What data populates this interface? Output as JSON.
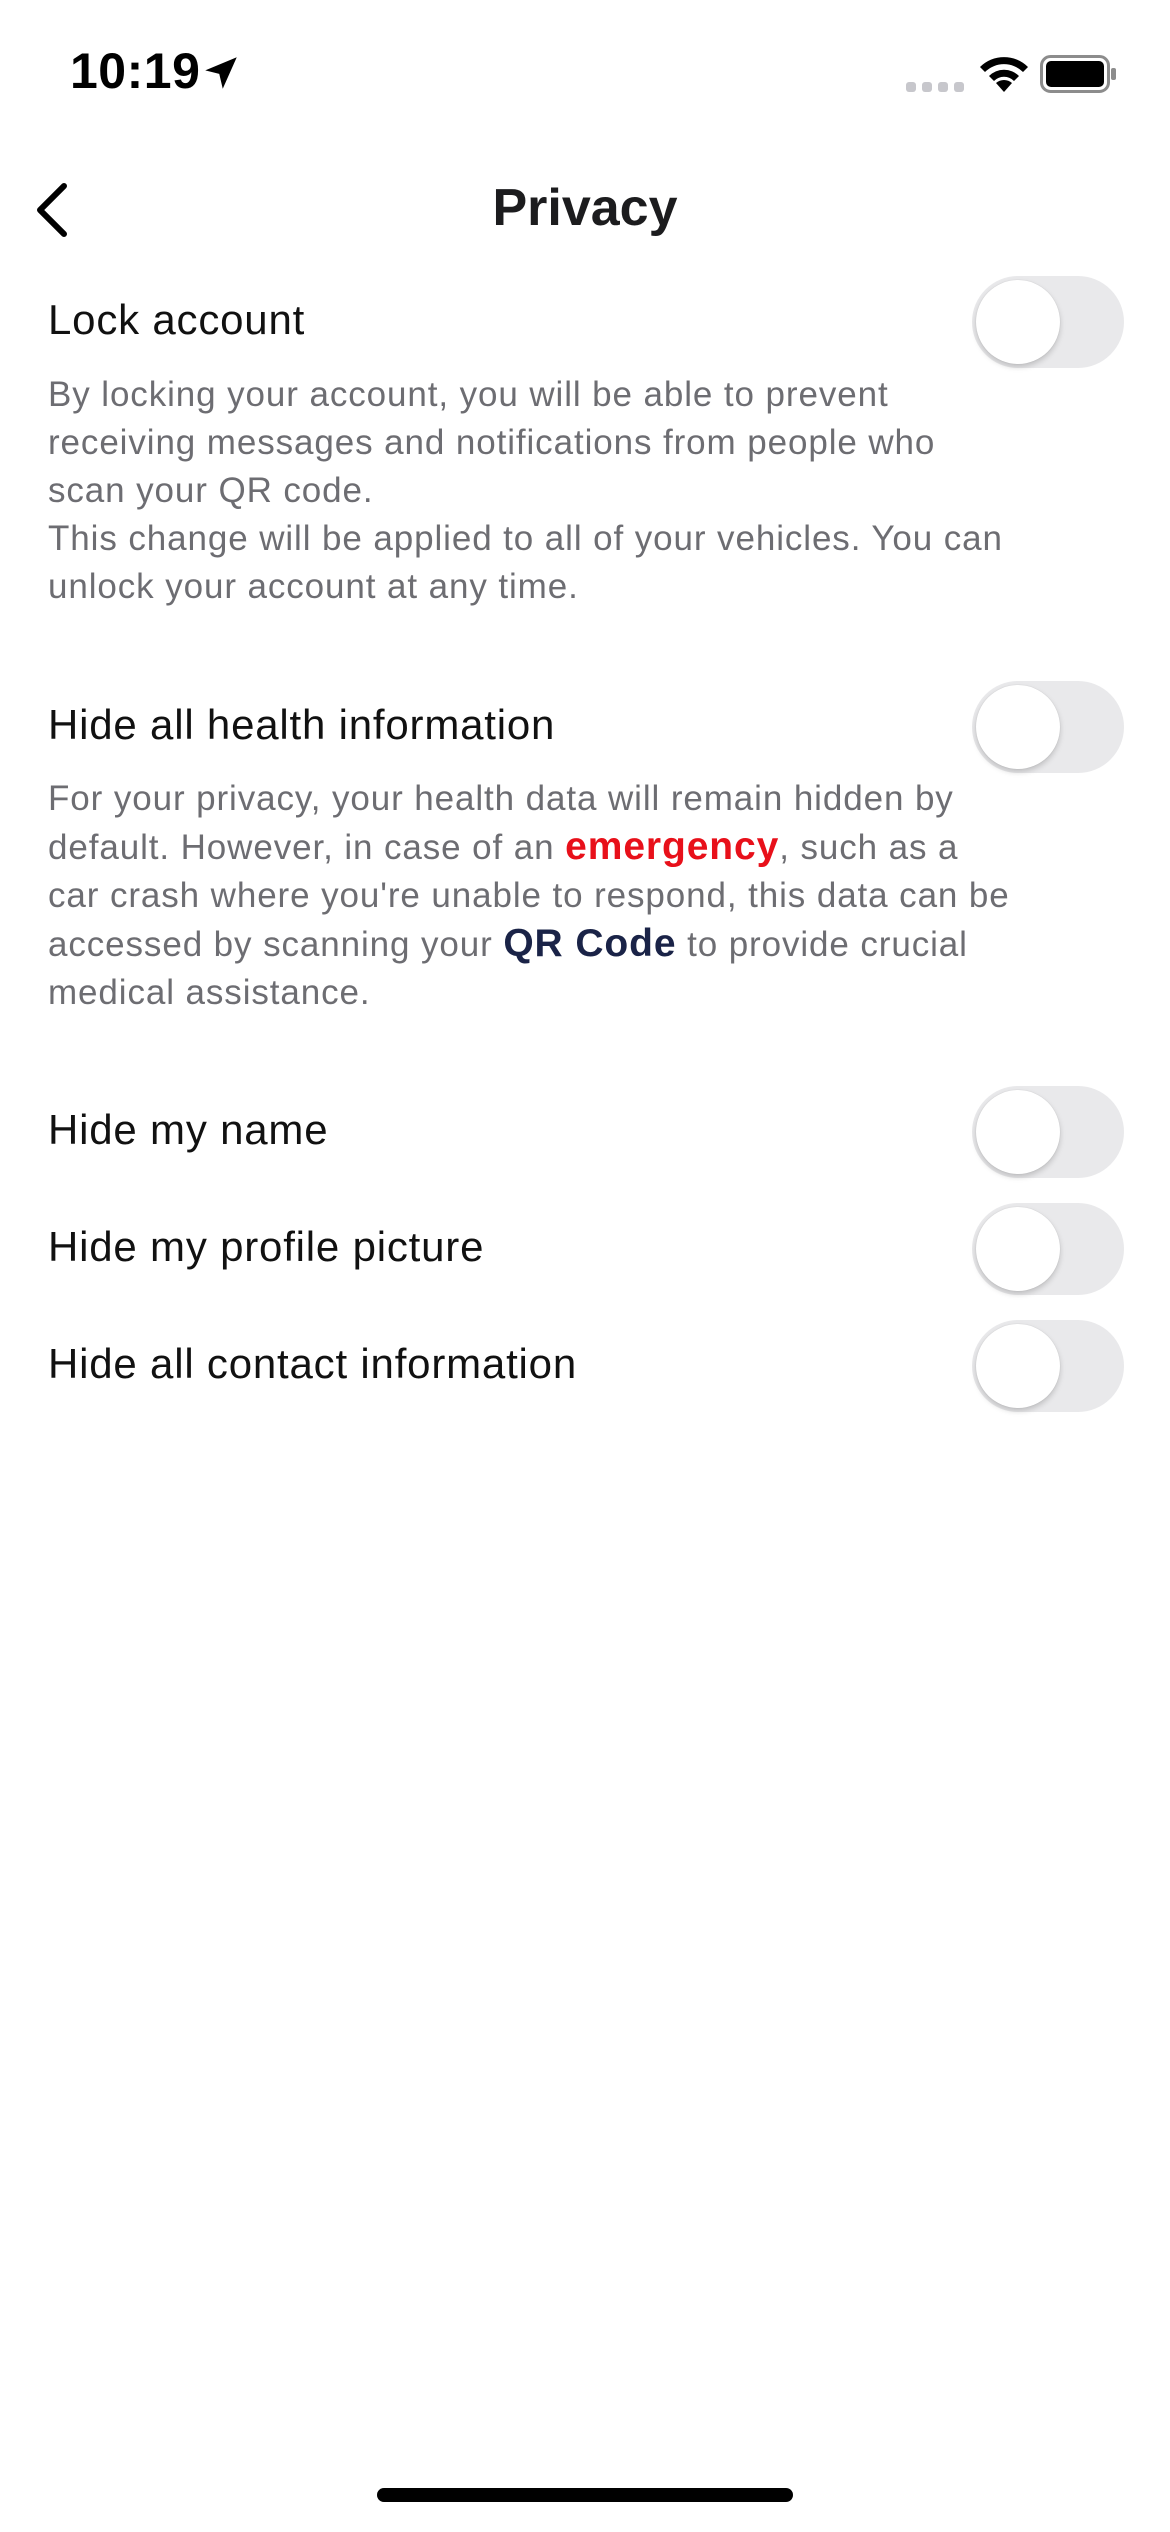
{
  "status_bar": {
    "time": "10:19",
    "icons": [
      "location-arrow-icon",
      "cellular-signal-icon",
      "wifi-icon",
      "battery-icon"
    ]
  },
  "nav": {
    "back_icon": "chevron-left-icon",
    "title": "Privacy"
  },
  "settings": {
    "lock_account": {
      "label": "Lock account",
      "enabled": false,
      "description_lines": [
        "By locking your account, you will be able to prevent",
        "receiving messages and notifications from people who",
        "scan your QR code.",
        "This change will be applied to all of your vehicles. You can",
        "unlock your account at any time."
      ]
    },
    "hide_health": {
      "label": "Hide all health information",
      "enabled": false,
      "description": {
        "line1": "For your privacy, your health data will remain hidden by",
        "line2_before": "default. However, in case of an ",
        "line2_emphasis": "emergency",
        "line2_after": ", such as a",
        "line3": "car crash where you're unable to respond, this data can be",
        "line4_before": "accessed by scanning your ",
        "line4_emphasis": "QR Code",
        "line4_after": " to provide crucial",
        "line5": "medical assistance."
      }
    },
    "hide_name": {
      "label": "Hide my name",
      "enabled": false
    },
    "hide_profile_picture": {
      "label": "Hide my profile picture",
      "enabled": false
    },
    "hide_contact": {
      "label": "Hide all contact information",
      "enabled": false
    }
  },
  "colors": {
    "toggle_off_track": "#e9e9eb",
    "emergency_text": "#e8101a",
    "qr_code_text": "#1a2347",
    "description_text": "#6d6d72"
  }
}
